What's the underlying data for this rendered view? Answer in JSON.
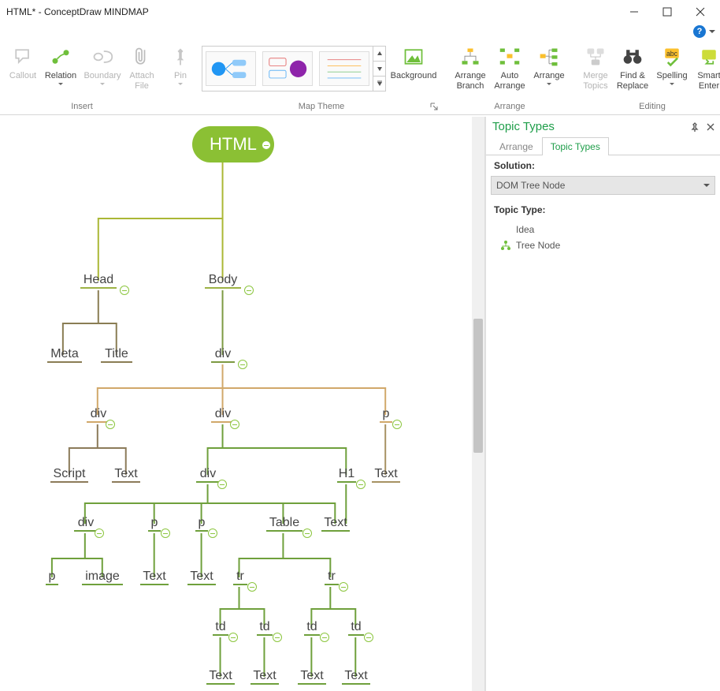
{
  "window": {
    "title": "HTML* - ConceptDraw MINDMAP"
  },
  "ribbon": {
    "groups": {
      "insert": {
        "label": "Insert"
      },
      "theme": {
        "label": "Map Theme"
      },
      "arrange": {
        "label": "Arrange"
      },
      "editing": {
        "label": "Editing"
      }
    },
    "buttons": {
      "callout": "Callout",
      "relation": "Relation",
      "boundary": "Boundary",
      "attach": "Attach File",
      "pin": "Pin",
      "background": "Background",
      "arr_branch": "Arrange Branch",
      "auto_arr": "Auto Arrange",
      "arrange": "Arrange",
      "merge": "Merge Topics",
      "findrep": "Find & Replace",
      "spelling": "Spelling",
      "smart": "Smart Enter"
    }
  },
  "panel": {
    "title": "Topic Types",
    "tabs": {
      "arrange": "Arrange",
      "types": "Topic Types"
    },
    "solution_label": "Solution:",
    "solution_value": "DOM Tree Node",
    "type_label": "Topic Type:",
    "types": {
      "idea": "Idea",
      "treenode": "Tree Node"
    }
  },
  "mindmap": {
    "root": "HTML",
    "head": "Head",
    "body": "Body",
    "meta": "Meta",
    "title": "Title",
    "div": "div",
    "p": "p",
    "script": "Script",
    "text": "Text",
    "h1": "H1",
    "image": "image",
    "table": "Table",
    "tr": "tr",
    "td": "td"
  },
  "chart_data": {
    "type": "tree",
    "title": "HTML DOM Tree",
    "root": {
      "label": "HTML",
      "children": [
        {
          "label": "Head",
          "children": [
            {
              "label": "Meta"
            },
            {
              "label": "Title"
            }
          ]
        },
        {
          "label": "Body",
          "children": [
            {
              "label": "div",
              "children": [
                {
                  "label": "div",
                  "children": [
                    {
                      "label": "Script"
                    },
                    {
                      "label": "Text"
                    }
                  ]
                },
                {
                  "label": "div",
                  "children": [
                    {
                      "label": "div",
                      "children": [
                        {
                          "label": "div",
                          "children": [
                            {
                              "label": "p"
                            },
                            {
                              "label": "image"
                            }
                          ]
                        },
                        {
                          "label": "p",
                          "children": [
                            {
                              "label": "Text"
                            }
                          ]
                        },
                        {
                          "label": "p",
                          "children": [
                            {
                              "label": "Text"
                            }
                          ]
                        },
                        {
                          "label": "Table",
                          "children": [
                            {
                              "label": "tr",
                              "children": [
                                {
                                  "label": "td",
                                  "children": [
                                    {
                                      "label": "Text"
                                    }
                                  ]
                                },
                                {
                                  "label": "td",
                                  "children": [
                                    {
                                      "label": "Text"
                                    }
                                  ]
                                }
                              ]
                            },
                            {
                              "label": "tr",
                              "children": [
                                {
                                  "label": "td",
                                  "children": [
                                    {
                                      "label": "Text"
                                    }
                                  ]
                                },
                                {
                                  "label": "td",
                                  "children": [
                                    {
                                      "label": "Text"
                                    }
                                  ]
                                }
                              ]
                            }
                          ]
                        },
                        {
                          "label": "Text"
                        }
                      ]
                    },
                    {
                      "label": "H1",
                      "children": [
                        {
                          "label": "Text"
                        }
                      ]
                    }
                  ]
                },
                {
                  "label": "p",
                  "children": [
                    {
                      "label": "Text"
                    }
                  ]
                }
              ]
            }
          ]
        }
      ]
    }
  }
}
